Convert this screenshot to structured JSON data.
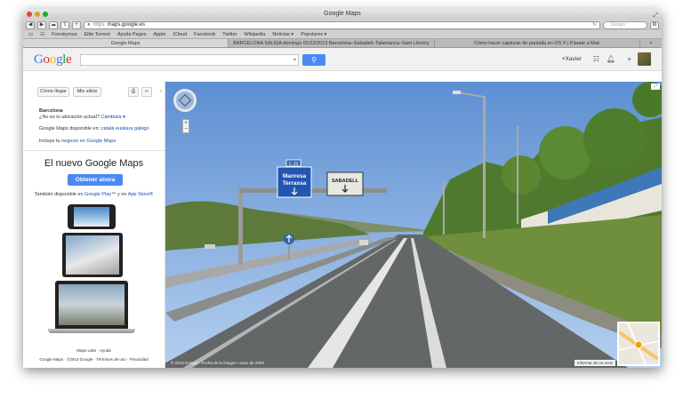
{
  "window": {
    "title": "Google Maps"
  },
  "toolbar": {
    "url_scheme": "https",
    "url": "maps.google.es",
    "search_placeholder": "Google"
  },
  "bookmarks": [
    "Fonokymus",
    "Elite Torrent",
    "Ayuda Pages",
    "Apple",
    "iCloud",
    "Facebook",
    "Twitter",
    "Wikipedia",
    "Noticias ▾",
    "Populares ▾"
  ],
  "tabs": [
    {
      "label": "Google Maps",
      "active": true
    },
    {
      "label": "BARCELONA SALIDA domingo 01/12/2013 Barcelona–Sabadell–Talamanca–Sant Llorenç",
      "active": false
    },
    {
      "label": "Cómo hacer capturas de pantalla en OS X | Pásate a Mac",
      "active": false
    }
  ],
  "header": {
    "logo": "Google",
    "user": "+Xavier",
    "search_value": ""
  },
  "sidebar": {
    "btn_directions": "Cómo llegar",
    "btn_my_places": "Mis sitios",
    "location_title": "Barcelona",
    "location_question": "¿No es tu ubicación actual?",
    "location_change": "Cámbiala ▾",
    "available_in": "Google Maps disponible en:",
    "languages": "català euskara galego",
    "include_prefix": "Incluye tu",
    "include_link": "negocio en Google Maps",
    "promo_title": "El nuevo Google Maps",
    "promo_button": "Obtener ahora",
    "promo_sub_prefix": "También disponible en",
    "promo_sub_link1": "Google Play™",
    "promo_sub_mid": "y en",
    "promo_sub_link2": "App Store®",
    "footer_links": "Maps Labs · Ayuda",
    "footer_copy": "Google Maps  · ©2013 Google · Términos de uso · Privacidad"
  },
  "streetview": {
    "sign_route": "C-33",
    "sign_blue_1": "Manresa",
    "sign_blue_2": "Terrassa",
    "sign_white": "SABADELL",
    "copyright": "© 2013 Google · Fecha de la imagen: mayo de 2009",
    "report": "Informar de un error"
  }
}
